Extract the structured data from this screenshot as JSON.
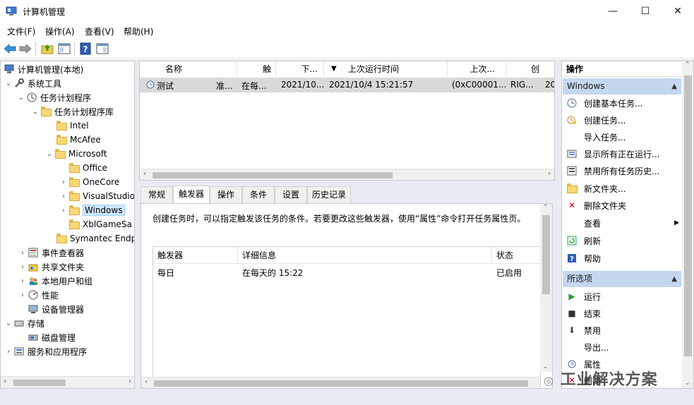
{
  "window": {
    "title": "计算机管理",
    "minimize_glyph": "—",
    "maximize_glyph": "☐",
    "close_glyph": "✕"
  },
  "menu": {
    "file": "文件(F)",
    "action": "操作(A)",
    "view": "查看(V)",
    "help": "帮助(H)"
  },
  "toolbar": {
    "icons": [
      "back-arrow-icon",
      "forward-arrow-icon",
      "up-folder-icon",
      "show-hide-tree-icon",
      "help-icon",
      "show-hide-action-pane-icon"
    ],
    "help_glyph": "?"
  },
  "tree": {
    "items": [
      {
        "label": "计算机管理(本地)",
        "icon": "computer-management-icon"
      },
      {
        "label": "系统工具",
        "icon": "system-tools-icon"
      },
      {
        "label": "任务计划程序",
        "icon": "task-scheduler-icon"
      },
      {
        "label": "任务计划程序库",
        "icon": "folder-icon"
      },
      {
        "label": "Intel",
        "icon": "folder-icon"
      },
      {
        "label": "McAfee",
        "icon": "folder-icon"
      },
      {
        "label": "Microsoft",
        "icon": "folder-icon"
      },
      {
        "label": "Office",
        "icon": "folder-icon"
      },
      {
        "label": "OneCore",
        "icon": "folder-icon"
      },
      {
        "label": "VisualStudio",
        "icon": "folder-icon"
      },
      {
        "label": "Windows",
        "icon": "folder-icon"
      },
      {
        "label": "XblGameSa",
        "icon": "folder-icon"
      },
      {
        "label": "Symantec Endp",
        "icon": "folder-icon"
      },
      {
        "label": "事件查看器",
        "icon": "event-viewer-icon"
      },
      {
        "label": "共享文件夹",
        "icon": "shared-folders-icon"
      },
      {
        "label": "本地用户和组",
        "icon": "users-groups-icon"
      },
      {
        "label": "性能",
        "icon": "performance-icon"
      },
      {
        "label": "设备管理器",
        "icon": "device-manager-icon"
      },
      {
        "label": "存储",
        "icon": "storage-icon"
      },
      {
        "label": "磁盘管理",
        "icon": "disk-management-icon"
      },
      {
        "label": "服务和应用程序",
        "icon": "services-apps-icon"
      }
    ],
    "selected": "Windows"
  },
  "tasklist": {
    "columns": [
      "名称",
      "触",
      "下...",
      "上次运行时间",
      "上次...",
      "创"
    ],
    "rows": [
      {
        "name": "测试",
        "status": "准...",
        "triggers": "在每...",
        "next_run": "2021/10...",
        "last_run": "2021/10/4 15:21:57",
        "last_result": "(0xC00001...",
        "author": "RIG...",
        "created": "20"
      }
    ]
  },
  "tabs": [
    "常规",
    "触发器",
    "操作",
    "条件",
    "设置",
    "历史记录"
  ],
  "active_tab": "触发器",
  "trigger_panel": {
    "description": "创建任务时，可以指定触发该任务的条件。若要更改这些触发器，使用“属性”命令打开任务属性页。",
    "columns": [
      "触发器",
      "详细信息",
      "状态"
    ],
    "rows": [
      {
        "trigger": "每日",
        "details": "在每天的 15:22",
        "status": "已启用"
      }
    ]
  },
  "actions_pane": {
    "title": "操作",
    "sections": [
      {
        "title": "Windows",
        "items": [
          {
            "label": "创建基本任务...",
            "icon": "create-basic-task-icon"
          },
          {
            "label": "创建任务...",
            "icon": "create-task-icon"
          },
          {
            "label": "导入任务...",
            "icon": ""
          },
          {
            "label": "显示所有正在运行...",
            "icon": "running-tasks-icon"
          },
          {
            "label": "禁用所有任务历史...",
            "icon": "disable-history-icon"
          },
          {
            "label": "新文件夹...",
            "icon": "new-folder-icon"
          },
          {
            "label": "删除文件夹",
            "icon": "delete-icon"
          },
          {
            "label": "查看",
            "icon": ""
          },
          {
            "label": "刷新",
            "icon": "refresh-icon"
          },
          {
            "label": "帮助",
            "icon": "help-icon"
          }
        ]
      },
      {
        "title": "所选项",
        "items": [
          {
            "label": "运行",
            "icon": "run-icon"
          },
          {
            "label": "结束",
            "icon": "stop-icon"
          },
          {
            "label": "禁用",
            "icon": "disable-icon"
          },
          {
            "label": "导出...",
            "icon": ""
          },
          {
            "label": "属性",
            "icon": "properties-icon"
          },
          {
            "label": "删除",
            "icon": "delete-icon"
          }
        ]
      }
    ]
  },
  "watermark": "工业解决方案",
  "colors": {
    "selection": "#cce8ff",
    "section_header": "#c5d7ee",
    "row_highlight": "#d9d9d9"
  }
}
